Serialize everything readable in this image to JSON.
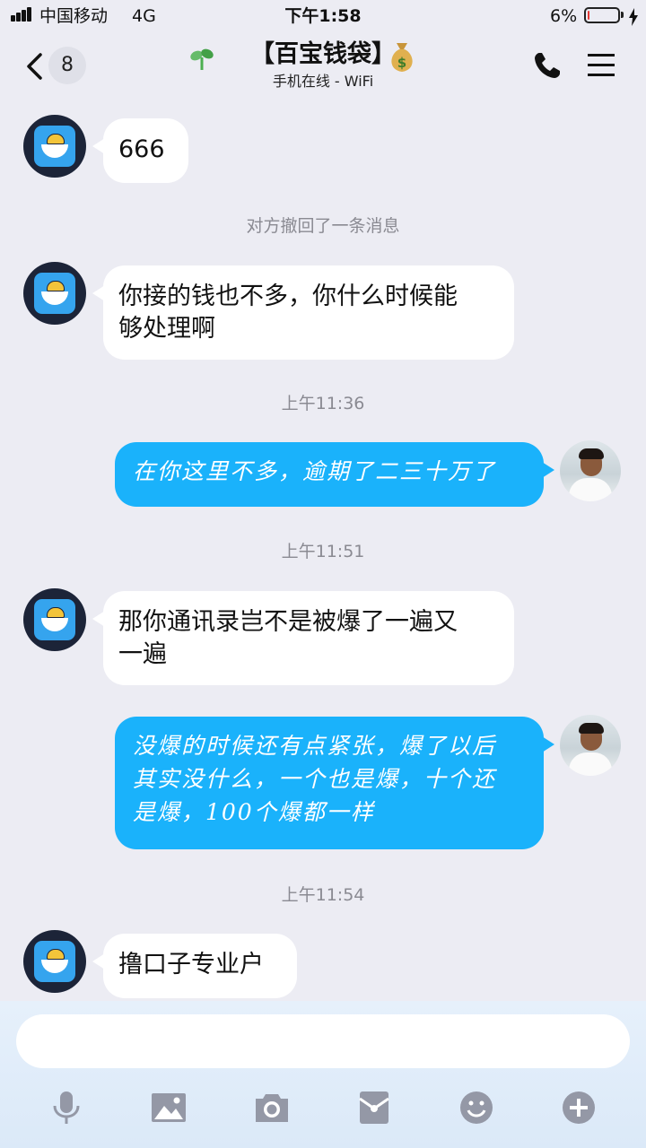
{
  "status_bar": {
    "carrier": "中国移动",
    "network": "4G",
    "time": "下午1:58",
    "battery_percent": "6%",
    "battery_level": 0.06,
    "battery_color": "#e53935"
  },
  "header": {
    "back_count": "8",
    "title": "【百宝钱袋】",
    "title_icon_left": "sprout-icon",
    "title_icon_right": "money-bag-icon",
    "subtitle": "手机在线 - WiFi",
    "call_icon": "phone-icon",
    "menu_icon": "hamburger-icon"
  },
  "chat": {
    "m1": "666",
    "recall_notice": "对方撤回了一条消息",
    "m2_l1": "你接的钱也不多，你什么时候能",
    "m2_l2": "够处理啊",
    "t1": "上午11:36",
    "m3": "在你这里不多，逾期了二三十万了",
    "t2": "上午11:51",
    "m4_l1": "那你通讯录岂不是被爆了一遍又",
    "m4_l2": "一遍",
    "m5_l1": "没爆的时候还有点紧张，爆了以后",
    "m5_l2": "其实没什么，一个也是爆，十个还",
    "m5_l3": "是爆，100个爆都一样",
    "t3": "上午11:54",
    "m6": "撸口子专业户"
  },
  "composer": {
    "input_value": "",
    "tools": [
      "microphone-icon",
      "image-icon",
      "camera-icon",
      "red-packet-icon",
      "emoji-icon",
      "plus-icon"
    ]
  },
  "colors": {
    "background": "#ececf3",
    "incoming_bubble": "#ffffff",
    "outgoing_bubble": "#1ab2fb",
    "tool_icons": "#9498a6"
  }
}
